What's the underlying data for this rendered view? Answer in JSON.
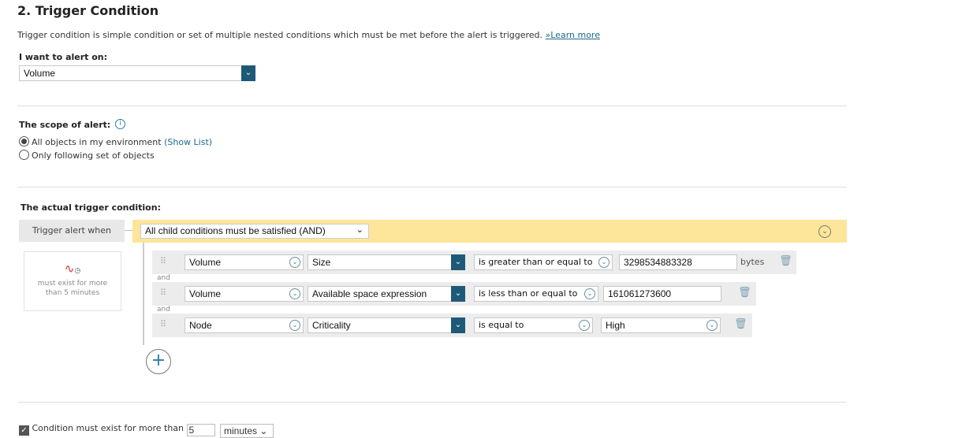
{
  "section_title": "2. Trigger Condition",
  "description": "Trigger condition is simple condition or set of multiple nested conditions which must be met before the alert is triggered.",
  "learn_more": "»Learn more",
  "alert_on": {
    "label": "I want to alert on:",
    "value": "Volume"
  },
  "scope": {
    "label": "The scope of alert:",
    "options": [
      {
        "label": "All objects in my environment",
        "link": "(Show List)",
        "selected": true
      },
      {
        "label": "Only following set of objects",
        "selected": false
      }
    ]
  },
  "trigger": {
    "label": "The actual trigger condition:",
    "when_label": "Trigger alert when",
    "mode": "All child conditions must be satisfied (AND)",
    "summary": "must exist for more than 5 minutes",
    "conditions": [
      {
        "object": "Volume",
        "property": "Size",
        "operator": "is greater than or equal to",
        "value": "3298534883328",
        "unit": "bytes"
      },
      {
        "object": "Volume",
        "property": "Available space expression",
        "operator": "is less than or equal to",
        "value": "161061273600"
      },
      {
        "object": "Node",
        "property": "Criticality",
        "operator": "is equal to",
        "value": "High"
      }
    ],
    "joiner": "and"
  },
  "duration": {
    "checked": true,
    "label": "Condition must exist for more than",
    "value": "5",
    "unit": "minutes"
  },
  "colors": {
    "accent": "#1e5a78",
    "highlight": "#fde59a",
    "link": "#1a6b8c"
  }
}
